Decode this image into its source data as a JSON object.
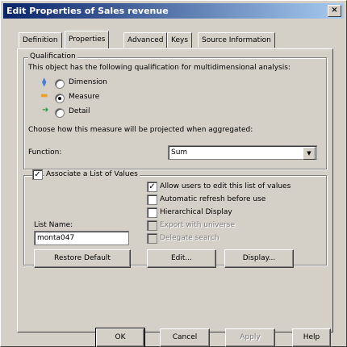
{
  "window": {
    "title": "Edit Properties of Sales revenue",
    "close": "×"
  },
  "tabs": [
    "Definition",
    "Properties",
    "Advanced",
    "Keys",
    "Source Information"
  ],
  "qualification": {
    "legend": "Qualification",
    "description": "This object has the following qualification for multidimensional analysis:",
    "options": [
      {
        "label": "Dimension",
        "selected": false
      },
      {
        "label": "Measure",
        "selected": true
      },
      {
        "label": "Detail",
        "selected": false
      }
    ],
    "projection_text": "Choose how this measure will be projected when aggregated:",
    "function_label": "Function:",
    "function_value": "Sum"
  },
  "lov": {
    "associate_label": "Associate a List of Values",
    "associate_checked": true,
    "allow_edit_label": "Allow users to edit this list of values",
    "auto_refresh_label": "Automatic refresh before use",
    "hierarchical_label": "Hierarchical Display",
    "export_label": "Export with universe",
    "delegate_label": "Delegate search",
    "list_name_label": "List Name:",
    "list_name_value": "monta047",
    "restore_label": "Restore Default",
    "edit_label": "Edit...",
    "display_label": "Display..."
  },
  "footer": {
    "ok": "OK",
    "cancel": "Cancel",
    "apply": "Apply",
    "help": "Help"
  },
  "colors": {
    "titlebar": "#0a246a",
    "dimension_icon": "#4a7fd8",
    "measure_icon": "#f0a020",
    "detail_icon": "#20a040"
  }
}
